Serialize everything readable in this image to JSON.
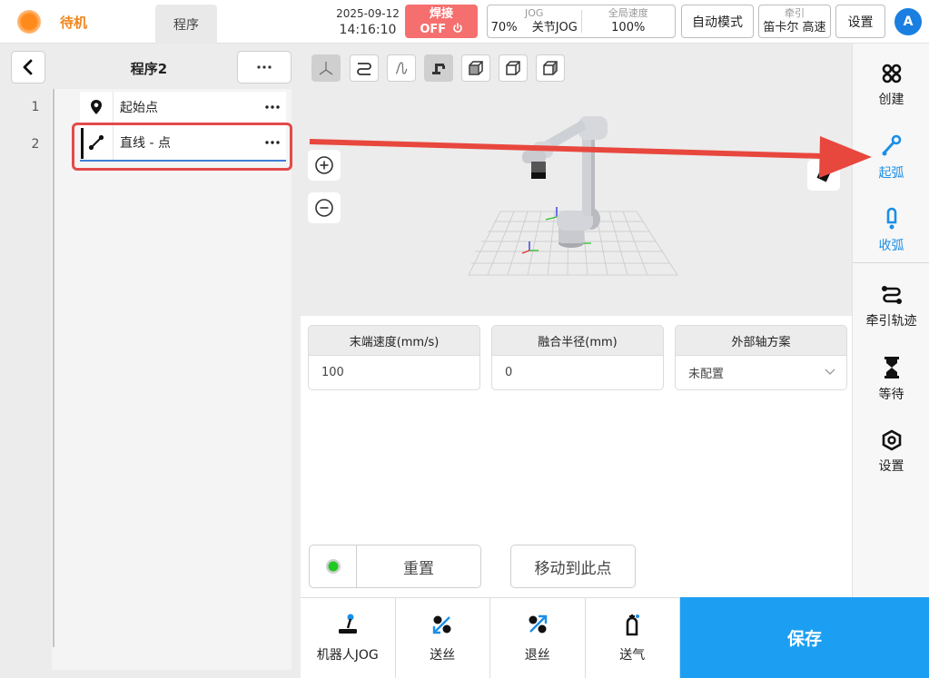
{
  "header": {
    "status": "待机",
    "program_tab": "程序",
    "date": "2025-09-12",
    "time": "14:16:10",
    "weld_label": "焊接",
    "weld_state": "OFF",
    "jog_label": "JOG",
    "jog_percent": "70%",
    "jog_mode": "关节JOG",
    "global_speed_label": "全局速度",
    "global_speed": "100%",
    "auto_mode": "自动模式",
    "traction_label": "牵引",
    "traction_value": "笛卡尔 高速",
    "settings": "设置",
    "avatar": "A"
  },
  "program": {
    "title": "程序2",
    "lines": [
      {
        "num": "1",
        "label": "起始点",
        "icon": "map-pin-icon"
      },
      {
        "num": "2",
        "label": "直线 - 点",
        "icon": "line-segment-icon"
      }
    ]
  },
  "params": {
    "end_speed_label": "末端速度(mm/s)",
    "end_speed_value": "100",
    "blend_radius_label": "融合半径(mm)",
    "blend_radius_value": "0",
    "ext_axis_label": "外部轴方案",
    "ext_axis_value": "未配置"
  },
  "actions": {
    "reset": "重置",
    "move_to_point": "移动到此点",
    "save": "保存"
  },
  "bottom_tools": [
    {
      "label": "机器人JOG",
      "icon": "joystick-icon"
    },
    {
      "label": "送丝",
      "icon": "wire-feed-icon"
    },
    {
      "label": "退丝",
      "icon": "wire-retract-icon"
    },
    {
      "label": "送气",
      "icon": "gas-cylinder-icon"
    }
  ],
  "right_tools": [
    {
      "label": "创建",
      "icon": "create-icon"
    },
    {
      "label": "起弧",
      "icon": "arc-start-icon"
    },
    {
      "label": "收弧",
      "icon": "arc-end-icon"
    },
    {
      "label": "牵引轨迹",
      "icon": "traction-path-icon"
    },
    {
      "label": "等待",
      "icon": "hourglass-icon"
    },
    {
      "label": "设置",
      "icon": "settings-hex-icon"
    }
  ],
  "colors": {
    "status_orange": "#f0861e",
    "weld_red": "#f56f6f",
    "accent_blue": "#1c9ff2",
    "highlight_red": "#e24b4b",
    "led_green": "#22c822"
  }
}
